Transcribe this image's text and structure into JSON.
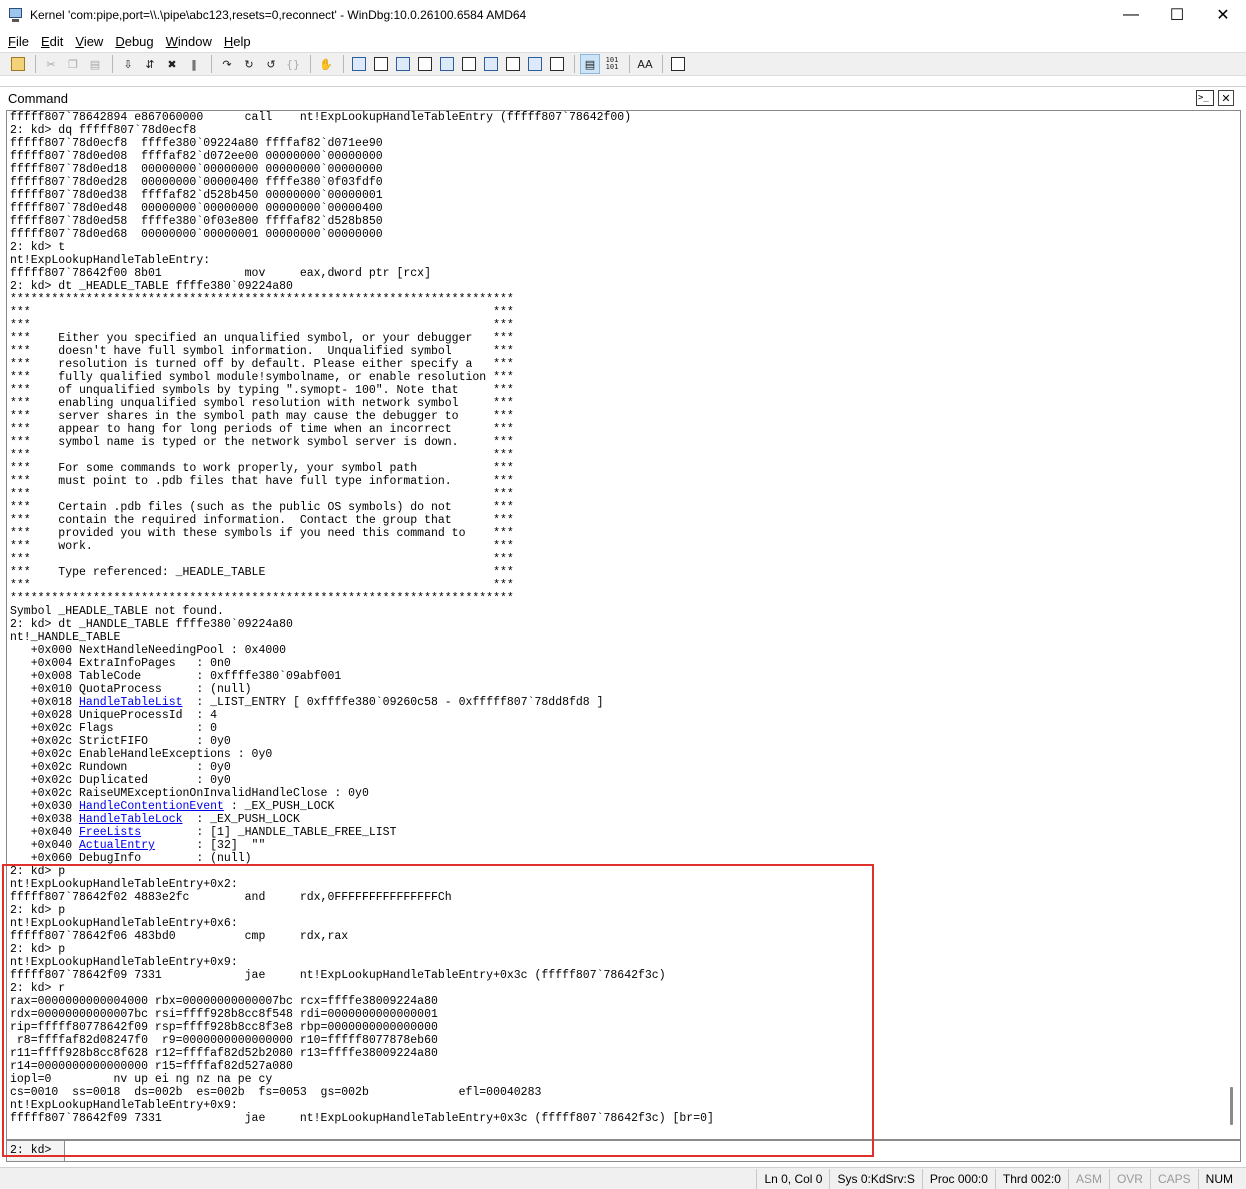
{
  "window": {
    "title": "Kernel 'com:pipe,port=\\\\.\\pipe\\abc123,resets=0,reconnect' - WinDbg:10.0.26100.6584 AMD64",
    "minimize_glyph": "—",
    "maximize_glyph": "☐",
    "close_glyph": "✕"
  },
  "menu": {
    "items": [
      {
        "label": "File",
        "key": "F",
        "rest": "ile"
      },
      {
        "label": "Edit",
        "key": "E",
        "rest": "dit"
      },
      {
        "label": "View",
        "key": "V",
        "rest": "iew"
      },
      {
        "label": "Debug",
        "key": "D",
        "rest": "ebug"
      },
      {
        "label": "Window",
        "key": "W",
        "rest": "indow"
      },
      {
        "label": "Help",
        "key": "H",
        "rest": "elp"
      }
    ]
  },
  "toolbar": {
    "font_label": "AA",
    "hex_label_1": "101",
    "hex_label_2": "101"
  },
  "pane": {
    "title": "Command",
    "cmd_icon_text": ">_",
    "close_glyph": "✕"
  },
  "output": {
    "lines": [
      "fffff807`78642894 e867060000      call    nt!ExpLookupHandleTableEntry (fffff807`78642f00)",
      "2: kd> dq fffff807`78d0ecf8",
      "fffff807`78d0ecf8  ffffe380`09224a80 ffffaf82`d071ee90",
      "fffff807`78d0ed08  ffffaf82`d072ee00 00000000`00000000",
      "fffff807`78d0ed18  00000000`00000000 00000000`00000000",
      "fffff807`78d0ed28  00000000`00000400 ffffe380`0f03fdf0",
      "fffff807`78d0ed38  ffffaf82`d528b450 00000000`00000001",
      "fffff807`78d0ed48  00000000`00000000 00000000`00000400",
      "fffff807`78d0ed58  ffffe380`0f03e800 ffffaf82`d528b850",
      "fffff807`78d0ed68  00000000`00000001 00000000`00000000",
      "2: kd> t",
      "nt!ExpLookupHandleTableEntry:",
      "fffff807`78642f00 8b01            mov     eax,dword ptr [rcx]",
      "2: kd> dt _HEADLE_TABLE ffffe380`09224a80",
      "*************************************************************************",
      "***                                                                   ***",
      "***                                                                   ***",
      "***    Either you specified an unqualified symbol, or your debugger   ***",
      "***    doesn't have full symbol information.  Unqualified symbol      ***",
      "***    resolution is turned off by default. Please either specify a   ***",
      "***    fully qualified symbol module!symbolname, or enable resolution ***",
      "***    of unqualified symbols by typing \".symopt- 100\". Note that     ***",
      "***    enabling unqualified symbol resolution with network symbol     ***",
      "***    server shares in the symbol path may cause the debugger to     ***",
      "***    appear to hang for long periods of time when an incorrect      ***",
      "***    symbol name is typed or the network symbol server is down.     ***",
      "***                                                                   ***",
      "***    For some commands to work properly, your symbol path           ***",
      "***    must point to .pdb files that have full type information.      ***",
      "***                                                                   ***",
      "***    Certain .pdb files (such as the public OS symbols) do not      ***",
      "***    contain the required information.  Contact the group that      ***",
      "***    provided you with these symbols if you need this command to    ***",
      "***    work.                                                          ***",
      "***                                                                   ***",
      "***    Type referenced: _HEADLE_TABLE                                 ***",
      "***                                                                   ***",
      "*************************************************************************",
      "Symbol _HEADLE_TABLE not found.",
      "2: kd> dt _HANDLE_TABLE ffffe380`09224a80",
      "nt!_HANDLE_TABLE",
      "   +0x000 NextHandleNeedingPool : 0x4000",
      "   +0x004 ExtraInfoPages   : 0n0",
      "   +0x008 TableCode        : 0xffffe380`09abf001",
      "   +0x010 QuotaProcess     : (null)",
      "   +0x018 |HandleTableList|  : _LIST_ENTRY [ 0xffffe380`09260c58 - 0xfffff807`78dd8fd8 ]",
      "   +0x028 UniqueProcessId  : 4",
      "   +0x02c Flags            : 0",
      "   +0x02c StrictFIFO       : 0y0",
      "   +0x02c EnableHandleExceptions : 0y0",
      "   +0x02c Rundown          : 0y0",
      "   +0x02c Duplicated       : 0y0",
      "   +0x02c RaiseUMExceptionOnInvalidHandleClose : 0y0",
      "   +0x030 |HandleContentionEvent| : _EX_PUSH_LOCK",
      "   +0x038 |HandleTableLock|  : _EX_PUSH_LOCK",
      "   +0x040 |FreeLists|        : [1] _HANDLE_TABLE_FREE_LIST",
      "   +0x040 |ActualEntry|      : [32]  \"\"",
      "   +0x060 DebugInfo        : (null)",
      "2: kd> p",
      "nt!ExpLookupHandleTableEntry+0x2:",
      "fffff807`78642f02 4883e2fc        and     rdx,0FFFFFFFFFFFFFFFCh",
      "2: kd> p",
      "nt!ExpLookupHandleTableEntry+0x6:",
      "fffff807`78642f06 483bd0          cmp     rdx,rax",
      "2: kd> p",
      "nt!ExpLookupHandleTableEntry+0x9:",
      "fffff807`78642f09 7331            jae     nt!ExpLookupHandleTableEntry+0x3c (fffff807`78642f3c)",
      "2: kd> r",
      "rax=0000000000004000 rbx=00000000000007bc rcx=ffffe38009224a80",
      "rdx=00000000000007bc rsi=ffff928b8cc8f548 rdi=0000000000000001",
      "rip=fffff80778642f09 rsp=ffff928b8cc8f3e8 rbp=0000000000000000",
      " r8=ffffaf82d08247f0  r9=0000000000000000 r10=fffff8077878eb60",
      "r11=ffff928b8cc8f628 r12=ffffaf82d52b2080 r13=ffffe38009224a80",
      "r14=0000000000000000 r15=ffffaf82d527a080",
      "iopl=0         nv up ei ng nz na pe cy",
      "cs=0010  ss=0018  ds=002b  es=002b  fs=0053  gs=002b             efl=00040283",
      "nt!ExpLookupHandleTableEntry+0x9:",
      "fffff807`78642f09 7331            jae     nt!ExpLookupHandleTableEntry+0x3c (fffff807`78642f3c) [br=0]"
    ]
  },
  "input": {
    "prompt": "2: kd>",
    "value": ""
  },
  "status": {
    "cells": [
      {
        "label": "Ln 0, Col 0",
        "dim": false
      },
      {
        "label": "Sys 0:KdSrv:S",
        "dim": false
      },
      {
        "label": "Proc 000:0",
        "dim": false
      },
      {
        "label": "Thrd 002:0",
        "dim": false
      },
      {
        "label": "ASM",
        "dim": true
      },
      {
        "label": "OVR",
        "dim": true
      },
      {
        "label": "CAPS",
        "dim": true
      },
      {
        "label": "NUM",
        "dim": false
      }
    ]
  },
  "colors": {
    "link": "#0000ee",
    "highlight_border": "#e0302b"
  }
}
